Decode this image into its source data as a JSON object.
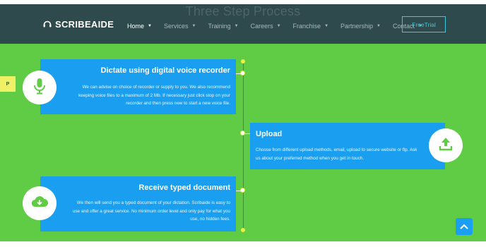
{
  "header": {
    "ghost_title": "Three Step Process",
    "logo_text": "SCRIBEAIDE",
    "nav": [
      {
        "label": "Home",
        "active": true
      },
      {
        "label": "Services",
        "active": false
      },
      {
        "label": "Training",
        "active": false
      },
      {
        "label": "Careers",
        "active": false
      },
      {
        "label": "Franchise",
        "active": false
      },
      {
        "label": "Partnership",
        "active": false
      },
      {
        "label": "Contact",
        "active": false
      }
    ],
    "cta_label": "FreeTrial"
  },
  "steps": [
    {
      "title": "Dictate using digital voice recorder",
      "text": "We can advise on choice of recorder or supply to you. We also recommend keeping voice files to a maximum of 2 Mb. If necessary just click stop on your recorder and then press new to start a new voice file.",
      "icon": "microphone-icon"
    },
    {
      "title": "Upload",
      "text": "Choose from different upload methods, email, upload to secure website or ftp. Ask us about your preferred method when you get in touch.",
      "icon": "upload-icon"
    },
    {
      "title": "Receive typed document",
      "text": "We then will send you a typed document of your dictation. Scribaide is easy to use and offer a great service. No minimum order level and only pay for what you use, no hidden fees.",
      "icon": "cloud-download-icon"
    }
  ],
  "side_tab_label": "P",
  "colors": {
    "header_bg": "#2f4a4c",
    "page_bg": "#60cc46",
    "card_bg": "#1a9ff0",
    "accent": "#38c9e0"
  }
}
